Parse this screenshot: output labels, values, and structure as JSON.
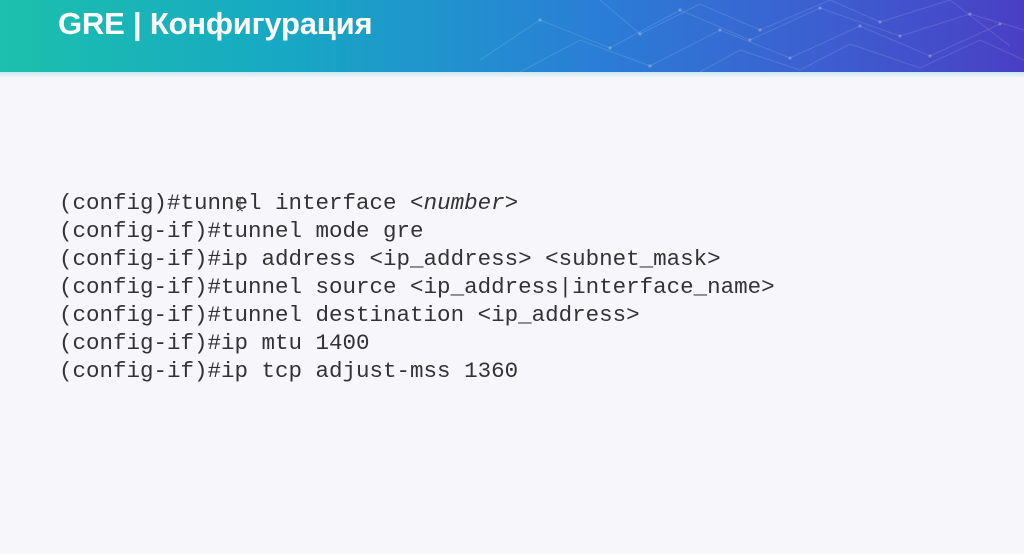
{
  "slide": {
    "title": "GRE | Конфигурация",
    "colors": {
      "header_gradient_start": "#1cc0ac",
      "header_gradient_end": "#4a3fc4",
      "title_text": "#ffffff",
      "background": "#f7f7fb",
      "code_text": "#333333"
    },
    "code_lines": [
      {
        "text": "(config)#tunnel interface <",
        "arg": "number",
        "suffix": ">"
      },
      {
        "text": "(config-if)#tunnel mode gre"
      },
      {
        "text": "(config-if)#ip address <ip_address> <subnet_mask>"
      },
      {
        "text": "(config-if)#tunnel source <ip_address|interface_name>"
      },
      {
        "text": "(config-if)#tunnel destination <ip_address>"
      },
      {
        "text": "(config-if)#ip mtu 1400"
      },
      {
        "text": "(config-if)#ip tcp adjust-mss 1360"
      }
    ],
    "cursor_icon": "text-cursor-icon"
  }
}
